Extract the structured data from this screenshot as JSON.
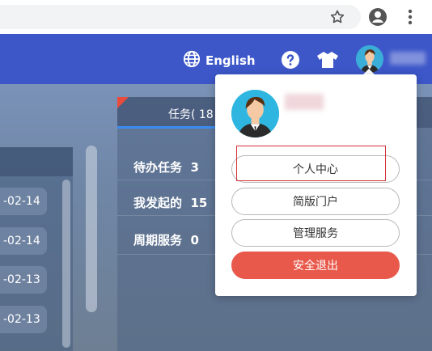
{
  "browser": {
    "icons": [
      "star-icon",
      "account-icon",
      "more-vertical-icon"
    ]
  },
  "header": {
    "language_label": "English",
    "icons": [
      "globe-icon",
      "help-icon",
      "shirt-icon",
      "avatar"
    ]
  },
  "tasks": {
    "tab_label": "任务( 18",
    "rows": [
      {
        "label": "待办任务",
        "count": "3"
      },
      {
        "label": "我发起的",
        "count": "15"
      },
      {
        "label": "周期服务",
        "count": "0"
      }
    ]
  },
  "left_list": {
    "dates": [
      "-02-14",
      "-02-14",
      "-02-13",
      "-02-13"
    ]
  },
  "dropdown": {
    "items": [
      "个人中心",
      "简版门户",
      "管理服务"
    ],
    "logout_label": "安全退出"
  },
  "colors": {
    "header_bg": "#3d57c9",
    "logout_bg": "#e8594b",
    "tab_accent": "#3b8cf0",
    "highlight": "#d0333b"
  }
}
